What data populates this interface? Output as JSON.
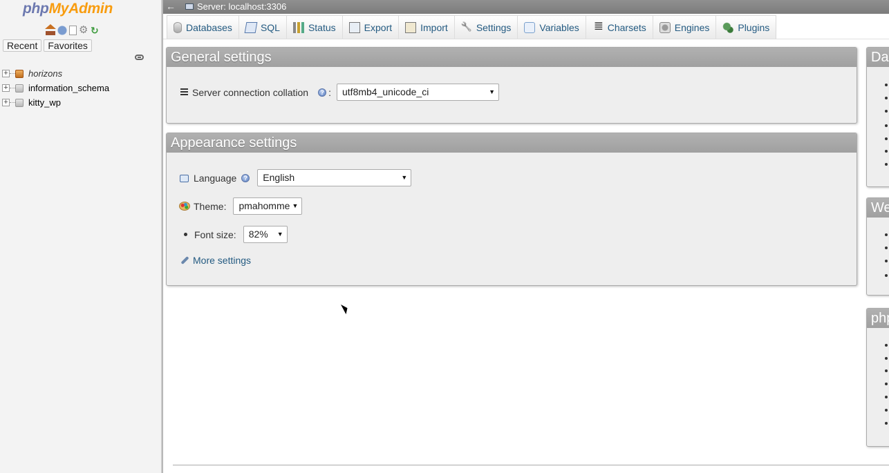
{
  "app": {
    "logo_php": "php",
    "logo_myadmin": "MyAdmin"
  },
  "nav": {
    "icons": [
      "home-icon",
      "help-icon",
      "documentation-icon",
      "settings-gear-icon",
      "reload-icon"
    ],
    "tabs": [
      "Recent",
      "Favorites"
    ],
    "databases": [
      {
        "name": "horizons",
        "style": "italic"
      },
      {
        "name": "information_schema",
        "style": "normal"
      },
      {
        "name": "kitty_wp",
        "style": "normal"
      }
    ]
  },
  "topbar": {
    "back": "←",
    "server": "Server: localhost:3306"
  },
  "menu": {
    "tabs": [
      {
        "label": "Databases",
        "icon": "database-icon"
      },
      {
        "label": "SQL",
        "icon": "sql-icon"
      },
      {
        "label": "Status",
        "icon": "status-icon"
      },
      {
        "label": "Export",
        "icon": "export-icon"
      },
      {
        "label": "Import",
        "icon": "import-icon"
      },
      {
        "label": "Settings",
        "icon": "wrench-icon"
      },
      {
        "label": "Variables",
        "icon": "variables-icon"
      },
      {
        "label": "Charsets",
        "icon": "charsets-icon"
      },
      {
        "label": "Engines",
        "icon": "engines-icon"
      },
      {
        "label": "Plugins",
        "icon": "plugins-icon"
      }
    ]
  },
  "general": {
    "title": "General settings",
    "collation_label": "Server connection collation",
    "collation_colon": ":",
    "collation_value": "utf8mb4_unicode_ci"
  },
  "appearance": {
    "title": "Appearance settings",
    "language_label": "Language",
    "language_value": "English",
    "theme_label": "Theme:",
    "theme_value": "pmahomme",
    "font_size_label": "Font size:",
    "font_size_value": "82%",
    "more_settings": "More settings"
  },
  "right_panels": [
    {
      "title": "Da"
    },
    {
      "title": "We"
    },
    {
      "title": "php"
    }
  ],
  "colors": {
    "link": "#235a81",
    "panel_header": "#a0a0a0",
    "nav_bg": "#f3f3f3",
    "logo_php": "#6c78af",
    "logo_myadmin": "#f89c0e"
  }
}
